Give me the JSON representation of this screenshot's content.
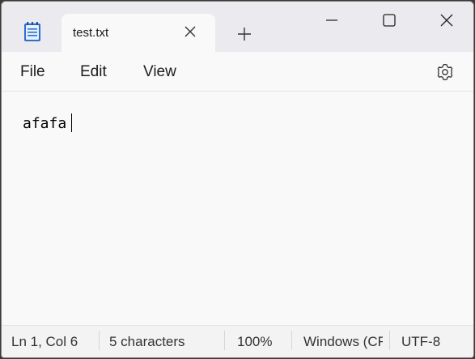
{
  "tab": {
    "title": "test.txt"
  },
  "menu": {
    "file": "File",
    "edit": "Edit",
    "view": "View"
  },
  "editor": {
    "content": "afafa"
  },
  "status": {
    "position": "Ln 1, Col 6",
    "characters": "5 characters",
    "zoom": "100%",
    "line_ending": "Windows (CRLF)",
    "encoding": "UTF-8"
  },
  "icons": {
    "app": "notepad-icon",
    "tab_close": "close-icon",
    "new_tab": "plus-icon",
    "minimize": "minimize-icon",
    "maximize": "maximize-icon",
    "close": "close-icon",
    "settings": "gear-icon"
  },
  "colors": {
    "titlebar": "#ebebef",
    "surface": "#f9f9f9",
    "statusbar": "#f3f3f3",
    "app_icon_blue": "#2b6fd3"
  }
}
